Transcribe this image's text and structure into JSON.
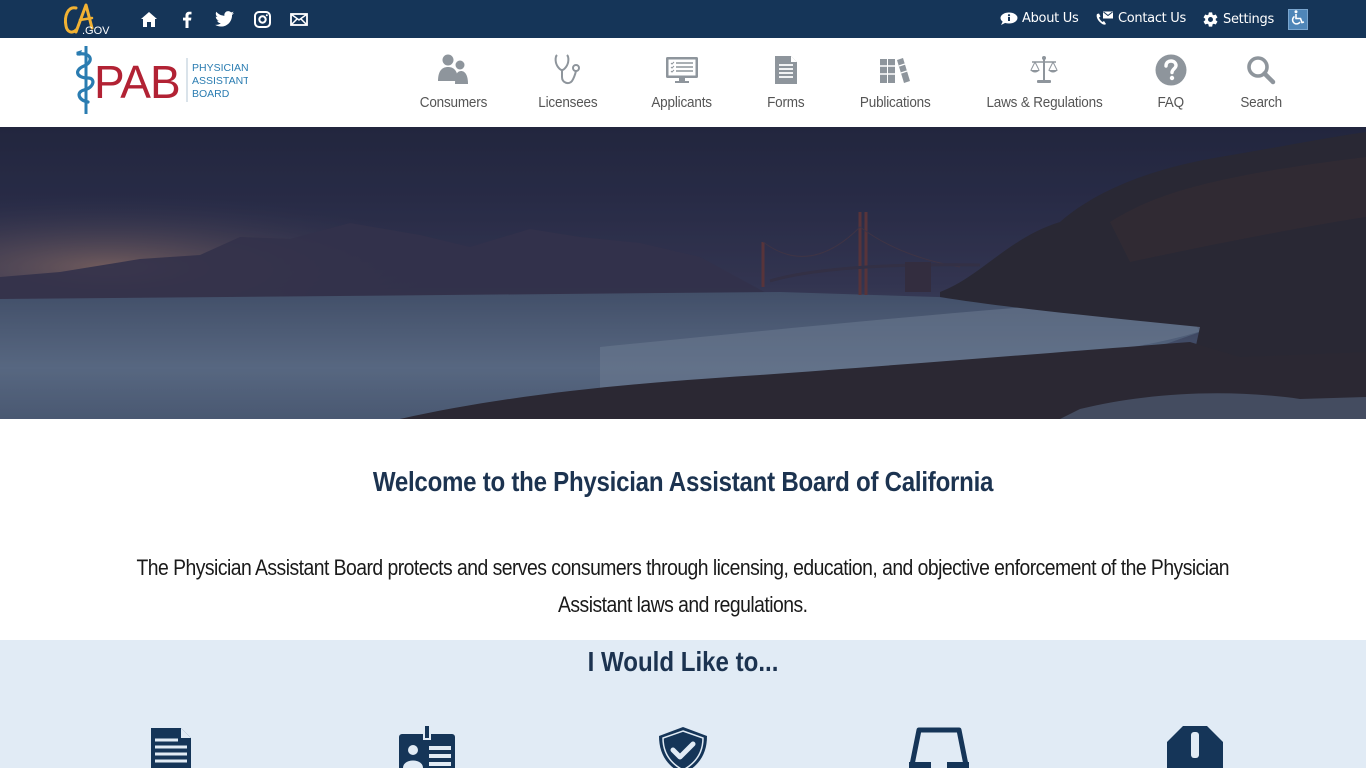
{
  "utility_bar": {
    "ca_gov_logo": "CA.GOV",
    "social_icons": [
      "home-icon",
      "facebook-icon",
      "twitter-icon",
      "instagram-icon",
      "email-icon"
    ],
    "links": [
      {
        "label": "About Us",
        "icon": "info-bubble-icon"
      },
      {
        "label": "Contact Us",
        "icon": "phone-envelope-icon"
      },
      {
        "label": "Settings",
        "icon": "gear-icon"
      }
    ],
    "accessibility_icon": "wheelchair-icon"
  },
  "header": {
    "logo": {
      "letters": "PAB",
      "line1": "PHYSICIAN",
      "line2": "ASSISTANT",
      "line3": "BOARD"
    },
    "nav": [
      {
        "label": "Consumers",
        "icon": "people-icon"
      },
      {
        "label": "Licensees",
        "icon": "stethoscope-icon"
      },
      {
        "label": "Applicants",
        "icon": "monitor-checklist-icon"
      },
      {
        "label": "Forms",
        "icon": "document-icon"
      },
      {
        "label": "Publications",
        "icon": "books-icon"
      },
      {
        "label": "Laws & Regulations",
        "icon": "scales-icon"
      },
      {
        "label": "FAQ",
        "icon": "question-circle-icon"
      },
      {
        "label": "Search",
        "icon": "magnifier-icon"
      }
    ]
  },
  "hero": {
    "image": "golden-gate-bridge-beach-dusk"
  },
  "welcome": {
    "title": "Welcome to the Physician Assistant Board of California",
    "line1": "The Physician Assistant Board protects and serves consumers through licensing, education, and objective enforcement of the Physician",
    "line2": "Assistant laws and regulations."
  },
  "i_would_like_to": {
    "title": "I Would Like to...",
    "icons": [
      "document-icon",
      "id-badge-icon",
      "shield-check-icon",
      "inbox-tray-icon",
      "octagon-alert-icon"
    ]
  },
  "colors": {
    "utility_bar": "#153558",
    "brand_red": "#b22234",
    "brand_blue": "#2a7cb1",
    "heading": "#1c3350",
    "nav_icon": "#8e959c",
    "section_bg": "#e1ebf5"
  }
}
